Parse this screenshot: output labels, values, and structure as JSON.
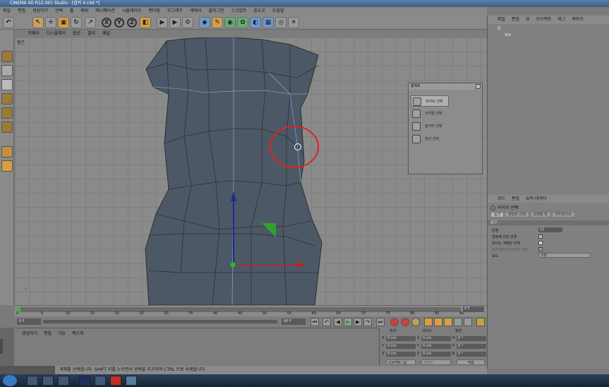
{
  "app": {
    "title": "CINEMA 4D R12.061 Studio - [컵의 4.c4d *]"
  },
  "menubar": [
    "파일",
    "편집",
    "생성하기",
    "선택",
    "툴",
    "메쉬",
    "애니메이션",
    "시뮬레이트",
    "렌더링",
    "모그래프",
    "캐릭터",
    "플러그인",
    "스크립트",
    "윈도우",
    "도움말"
  ],
  "viewport": {
    "menu": [
      "카메라",
      "디스플레이",
      "옵션",
      "필터",
      "패널"
    ],
    "label": "원근"
  },
  "popup": {
    "title": "팔레트",
    "items": [
      "라이브 선택",
      "사각형 선택",
      "올가미 선택",
      "직선 선택"
    ]
  },
  "object_manager": {
    "menu": [
      "파일",
      "편집",
      "뷰",
      "오브젝트",
      "태그",
      "북마크"
    ],
    "items": [
      "빈",
      "큐브"
    ]
  },
  "attributes": {
    "menu": [
      "모드",
      "편집",
      "유저 데이터"
    ],
    "title": "라이브 선택",
    "tabs": [
      "옵션",
      "정밀한 선택",
      "모델링 축",
      "하이퍼너브"
    ],
    "section": "옵션",
    "rows": [
      {
        "label": "반경",
        "value": "12"
      },
      {
        "label": "압력에 의한 반경",
        "value": ""
      },
      {
        "label": "보이는 개체만 선택",
        "value": ""
      },
      {
        "label": "엣지/폴리곤 선택을 위한",
        "value": ""
      },
      {
        "label": "모드",
        "value": "기본"
      }
    ]
  },
  "timeline": {
    "ticks": [
      "0",
      "5",
      "10",
      "15",
      "20",
      "25",
      "30",
      "35",
      "40",
      "45",
      "50",
      "55",
      "60",
      "65",
      "70",
      "75",
      "80",
      "85",
      "90"
    ],
    "frame": "0 F",
    "start": "0 F",
    "end": "90 F"
  },
  "material": {
    "menu": [
      "생성하기",
      "편집",
      "기능",
      "텍스쳐"
    ]
  },
  "coords": {
    "headers": [
      "위치",
      "사이즈",
      "회전"
    ],
    "axes": [
      "X",
      "Y",
      "Z"
    ],
    "pos": [
      "0 cm",
      "0 cm",
      "0 cm"
    ],
    "size": [
      "0 cm",
      "0 cm",
      "0 cm"
    ],
    "rot": [
      "0 °",
      "0 °",
      "0 °"
    ],
    "mode1": "오브젝트 (상",
    "mode2": "사이즈",
    "apply": "적용"
  },
  "status": {
    "text": "개체를 선택합니다. SHIFT 키를 누르면서 선택을 추가하며 CTRL 키로 삭제합니다."
  },
  "colors": {
    "mesh": "#4d5866",
    "circle": "#e0231f",
    "title": "#3b5f87"
  }
}
